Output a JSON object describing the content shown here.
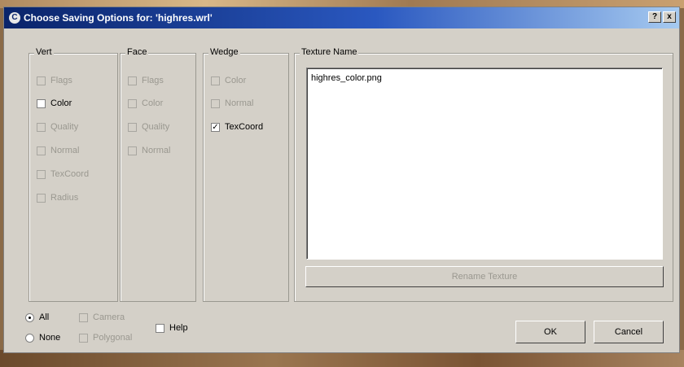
{
  "window": {
    "title": "Choose Saving Options for: 'highres.wrl'",
    "help_btn": "?",
    "close_btn": "x"
  },
  "groups": {
    "vert": {
      "title": "Vert",
      "items": [
        {
          "label": "Flags",
          "checked": false,
          "enabled": false
        },
        {
          "label": "Color",
          "checked": false,
          "enabled": true
        },
        {
          "label": "Quality",
          "checked": false,
          "enabled": false
        },
        {
          "label": "Normal",
          "checked": false,
          "enabled": false
        },
        {
          "label": "TexCoord",
          "checked": false,
          "enabled": false
        },
        {
          "label": "Radius",
          "checked": false,
          "enabled": false
        }
      ]
    },
    "face": {
      "title": "Face",
      "items": [
        {
          "label": "Flags",
          "checked": false,
          "enabled": false
        },
        {
          "label": "Color",
          "checked": false,
          "enabled": false
        },
        {
          "label": "Quality",
          "checked": false,
          "enabled": false
        },
        {
          "label": "Normal",
          "checked": false,
          "enabled": false
        }
      ]
    },
    "wedge": {
      "title": "Wedge",
      "items": [
        {
          "label": "Color",
          "checked": false,
          "enabled": false
        },
        {
          "label": "Normal",
          "checked": false,
          "enabled": false
        },
        {
          "label": "TexCoord",
          "checked": true,
          "enabled": true
        }
      ]
    }
  },
  "texture": {
    "title": "Texture Name",
    "files": [
      "highres_color.png"
    ],
    "rename_label": "Rename Texture"
  },
  "bottom": {
    "all_label": "All",
    "none_label": "None",
    "camera_label": "Camera",
    "polygonal_label": "Polygonal",
    "help_label": "Help",
    "ok_label": "OK",
    "cancel_label": "Cancel"
  }
}
